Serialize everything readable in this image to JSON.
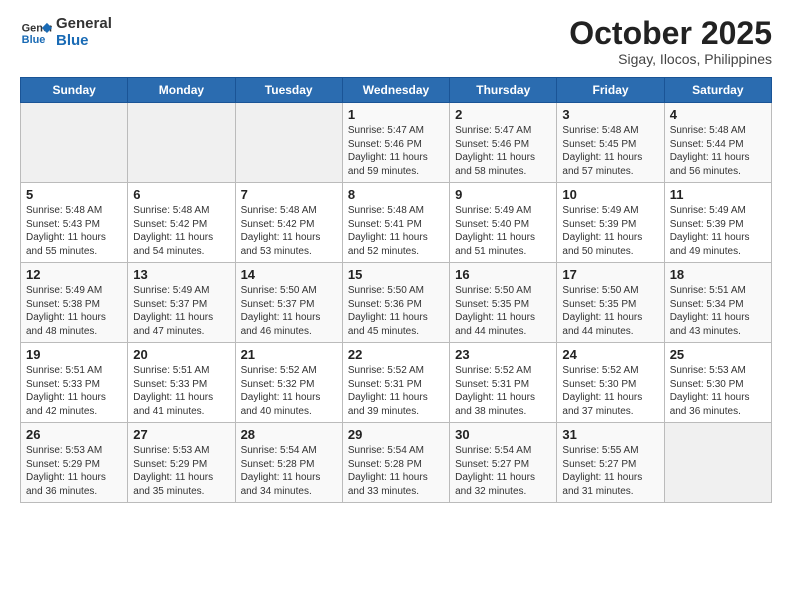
{
  "header": {
    "logo": {
      "line1": "General",
      "line2": "Blue"
    },
    "title": "October 2025",
    "subtitle": "Sigay, Ilocos, Philippines"
  },
  "weekdays": [
    "Sunday",
    "Monday",
    "Tuesday",
    "Wednesday",
    "Thursday",
    "Friday",
    "Saturday"
  ],
  "weeks": [
    [
      {
        "day": "",
        "info": ""
      },
      {
        "day": "",
        "info": ""
      },
      {
        "day": "",
        "info": ""
      },
      {
        "day": "1",
        "info": "Sunrise: 5:47 AM\nSunset: 5:46 PM\nDaylight: 11 hours\nand 59 minutes."
      },
      {
        "day": "2",
        "info": "Sunrise: 5:47 AM\nSunset: 5:46 PM\nDaylight: 11 hours\nand 58 minutes."
      },
      {
        "day": "3",
        "info": "Sunrise: 5:48 AM\nSunset: 5:45 PM\nDaylight: 11 hours\nand 57 minutes."
      },
      {
        "day": "4",
        "info": "Sunrise: 5:48 AM\nSunset: 5:44 PM\nDaylight: 11 hours\nand 56 minutes."
      }
    ],
    [
      {
        "day": "5",
        "info": "Sunrise: 5:48 AM\nSunset: 5:43 PM\nDaylight: 11 hours\nand 55 minutes."
      },
      {
        "day": "6",
        "info": "Sunrise: 5:48 AM\nSunset: 5:42 PM\nDaylight: 11 hours\nand 54 minutes."
      },
      {
        "day": "7",
        "info": "Sunrise: 5:48 AM\nSunset: 5:42 PM\nDaylight: 11 hours\nand 53 minutes."
      },
      {
        "day": "8",
        "info": "Sunrise: 5:48 AM\nSunset: 5:41 PM\nDaylight: 11 hours\nand 52 minutes."
      },
      {
        "day": "9",
        "info": "Sunrise: 5:49 AM\nSunset: 5:40 PM\nDaylight: 11 hours\nand 51 minutes."
      },
      {
        "day": "10",
        "info": "Sunrise: 5:49 AM\nSunset: 5:39 PM\nDaylight: 11 hours\nand 50 minutes."
      },
      {
        "day": "11",
        "info": "Sunrise: 5:49 AM\nSunset: 5:39 PM\nDaylight: 11 hours\nand 49 minutes."
      }
    ],
    [
      {
        "day": "12",
        "info": "Sunrise: 5:49 AM\nSunset: 5:38 PM\nDaylight: 11 hours\nand 48 minutes."
      },
      {
        "day": "13",
        "info": "Sunrise: 5:49 AM\nSunset: 5:37 PM\nDaylight: 11 hours\nand 47 minutes."
      },
      {
        "day": "14",
        "info": "Sunrise: 5:50 AM\nSunset: 5:37 PM\nDaylight: 11 hours\nand 46 minutes."
      },
      {
        "day": "15",
        "info": "Sunrise: 5:50 AM\nSunset: 5:36 PM\nDaylight: 11 hours\nand 45 minutes."
      },
      {
        "day": "16",
        "info": "Sunrise: 5:50 AM\nSunset: 5:35 PM\nDaylight: 11 hours\nand 44 minutes."
      },
      {
        "day": "17",
        "info": "Sunrise: 5:50 AM\nSunset: 5:35 PM\nDaylight: 11 hours\nand 44 minutes."
      },
      {
        "day": "18",
        "info": "Sunrise: 5:51 AM\nSunset: 5:34 PM\nDaylight: 11 hours\nand 43 minutes."
      }
    ],
    [
      {
        "day": "19",
        "info": "Sunrise: 5:51 AM\nSunset: 5:33 PM\nDaylight: 11 hours\nand 42 minutes."
      },
      {
        "day": "20",
        "info": "Sunrise: 5:51 AM\nSunset: 5:33 PM\nDaylight: 11 hours\nand 41 minutes."
      },
      {
        "day": "21",
        "info": "Sunrise: 5:52 AM\nSunset: 5:32 PM\nDaylight: 11 hours\nand 40 minutes."
      },
      {
        "day": "22",
        "info": "Sunrise: 5:52 AM\nSunset: 5:31 PM\nDaylight: 11 hours\nand 39 minutes."
      },
      {
        "day": "23",
        "info": "Sunrise: 5:52 AM\nSunset: 5:31 PM\nDaylight: 11 hours\nand 38 minutes."
      },
      {
        "day": "24",
        "info": "Sunrise: 5:52 AM\nSunset: 5:30 PM\nDaylight: 11 hours\nand 37 minutes."
      },
      {
        "day": "25",
        "info": "Sunrise: 5:53 AM\nSunset: 5:30 PM\nDaylight: 11 hours\nand 36 minutes."
      }
    ],
    [
      {
        "day": "26",
        "info": "Sunrise: 5:53 AM\nSunset: 5:29 PM\nDaylight: 11 hours\nand 36 minutes."
      },
      {
        "day": "27",
        "info": "Sunrise: 5:53 AM\nSunset: 5:29 PM\nDaylight: 11 hours\nand 35 minutes."
      },
      {
        "day": "28",
        "info": "Sunrise: 5:54 AM\nSunset: 5:28 PM\nDaylight: 11 hours\nand 34 minutes."
      },
      {
        "day": "29",
        "info": "Sunrise: 5:54 AM\nSunset: 5:28 PM\nDaylight: 11 hours\nand 33 minutes."
      },
      {
        "day": "30",
        "info": "Sunrise: 5:54 AM\nSunset: 5:27 PM\nDaylight: 11 hours\nand 32 minutes."
      },
      {
        "day": "31",
        "info": "Sunrise: 5:55 AM\nSunset: 5:27 PM\nDaylight: 11 hours\nand 31 minutes."
      },
      {
        "day": "",
        "info": ""
      }
    ]
  ]
}
